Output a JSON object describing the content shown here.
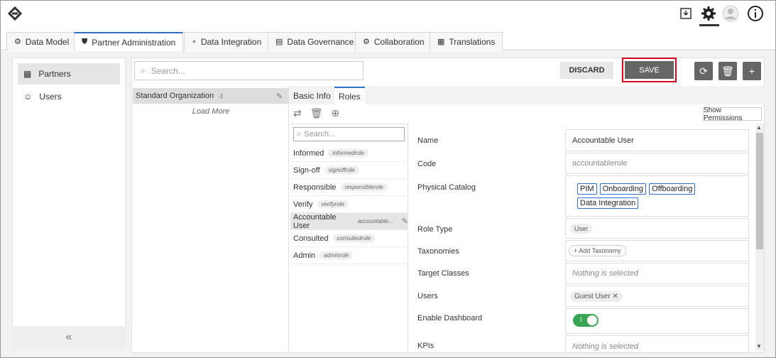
{
  "topbar": {
    "icons": [
      "logo-icon",
      "export-icon",
      "gear-icon",
      "avatar-icon",
      "info-icon"
    ]
  },
  "tabs": [
    {
      "label": "Data Model",
      "icon": "cubes-icon"
    },
    {
      "label": "Partner Administration",
      "icon": "shield-icon"
    },
    {
      "label": "Data Integration",
      "icon": "nodes-icon"
    },
    {
      "label": "Data Governance",
      "icon": "doc-search-icon"
    },
    {
      "label": "Collaboration",
      "icon": "gears-icon"
    },
    {
      "label": "Translations",
      "icon": "translate-icon"
    }
  ],
  "sidebar": {
    "items": [
      {
        "label": "Partners"
      },
      {
        "label": "Users"
      }
    ],
    "collapse": "«"
  },
  "search": {
    "placeholder": "Search..."
  },
  "actions": {
    "discard": "DISCARD",
    "save": "SAVE"
  },
  "org": {
    "name": "Standard Organization",
    "count": "-1",
    "load_more": "Load More"
  },
  "subtabs": {
    "basic_info": "Basic Info",
    "roles": "Roles"
  },
  "show_permissions": "Show Permissions",
  "roles": {
    "search_placeholder": "Search...",
    "items": [
      {
        "name": "Informed",
        "code": "informedrole"
      },
      {
        "name": "Sign-off",
        "code": "signoffrole"
      },
      {
        "name": "Responsible",
        "code": "responsiblerole"
      },
      {
        "name": "Verify",
        "code": "verifyrole"
      },
      {
        "name": "Accountable User",
        "code": "accountable..."
      },
      {
        "name": "Consulted",
        "code": "consultedrole"
      },
      {
        "name": "Admin",
        "code": "adminrole"
      }
    ]
  },
  "form": {
    "name_label": "Name",
    "name_value": "Accountable User",
    "code_label": "Code",
    "code_value": "accountablerole",
    "catalog_label": "Physical Catalog",
    "catalogs": [
      "PIM",
      "Onboarding",
      "Offboarding",
      "Data Integration"
    ],
    "role_type_label": "Role Type",
    "role_type_value": "User",
    "taxonomies_label": "Taxonomies",
    "add_taxonomy": "+ Add Taxonomy",
    "target_classes_label": "Target Classes",
    "target_classes_value": "Nothing is selected",
    "users_label": "Users",
    "users_value": "Guest User",
    "dashboard_label": "Enable Dashboard",
    "dashboard_toggle": "I",
    "kpis_label": "KPIs",
    "kpis_value": "Nothing is selected"
  }
}
